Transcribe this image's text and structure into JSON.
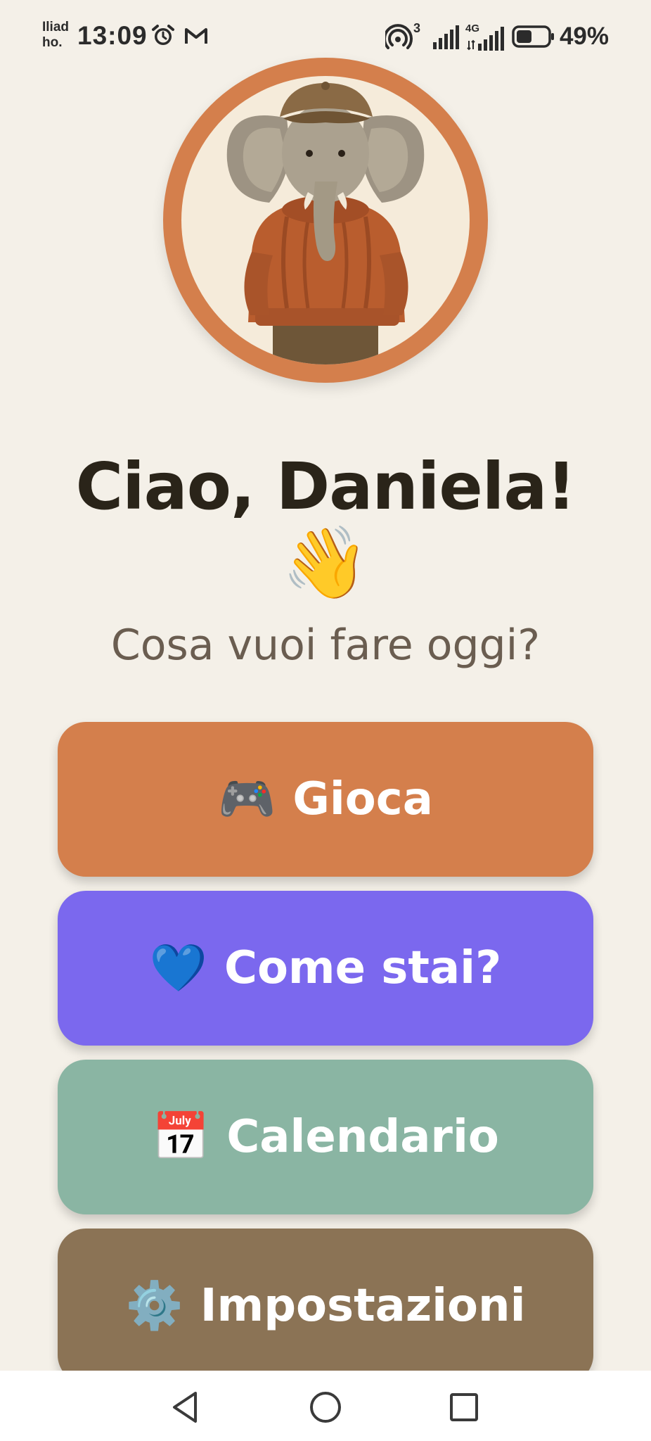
{
  "status_bar": {
    "carrier_line1": "Iliad",
    "carrier_line2": "ho.",
    "time": "13:09",
    "icons": [
      "alarm-icon",
      "gmail-icon",
      "hotspot-icon",
      "signal-icon",
      "4g-signal-icon",
      "battery-icon"
    ],
    "hotspot_count": "3",
    "network_label": "4G",
    "battery_percent": "49%",
    "battery_level": 0.49
  },
  "profile": {
    "avatar": "elephant-avatar",
    "ring_color": "#D47F4C"
  },
  "greeting": {
    "title": "Ciao, Daniela!",
    "emoji": "👋",
    "subtitle": "Cosa vuoi fare oggi?"
  },
  "menu": [
    {
      "icon": "🎮",
      "icon_name": "gamepad-icon",
      "label": "Gioca",
      "color": "#D47F4C"
    },
    {
      "icon": "💙",
      "icon_name": "blue-heart-icon",
      "label": "Come stai?",
      "color": "#7B68EE"
    },
    {
      "icon": "📅",
      "icon_name": "calendar-icon",
      "label": "Calendario",
      "color": "#8AB5A3"
    },
    {
      "icon": "⚙️",
      "icon_name": "gear-icon",
      "label": "Impostazioni",
      "color": "#8B7355"
    }
  ],
  "nav_bar": {
    "buttons": [
      "back-icon",
      "home-icon",
      "recents-icon"
    ]
  }
}
